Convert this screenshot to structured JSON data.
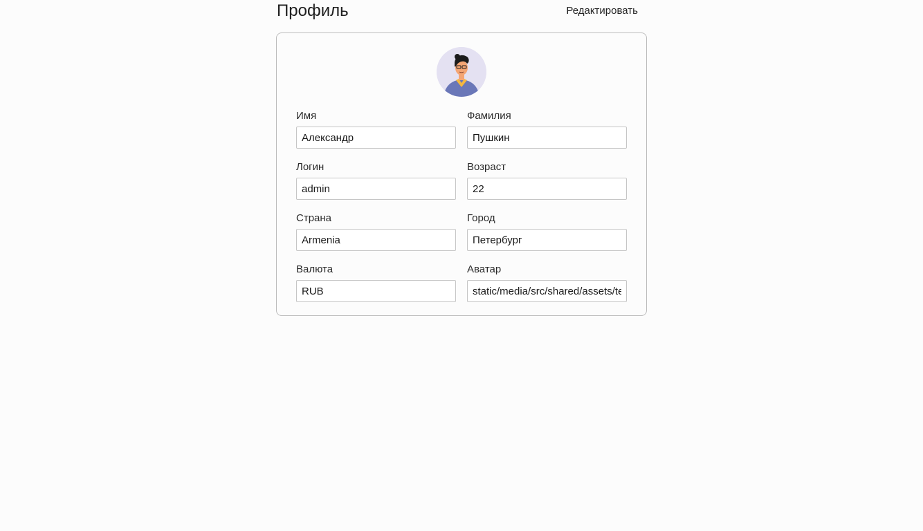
{
  "header": {
    "title": "Профиль",
    "edit_label": "Редактировать"
  },
  "avatar": {
    "icon": "user-avatar-illustration",
    "colors": {
      "background": "#e4e1f2",
      "shirt": "#6a77b8",
      "hair": "#1b1b1b",
      "skin": "#f4a574"
    }
  },
  "form": {
    "first_name": {
      "label": "Имя",
      "value": "Александр"
    },
    "last_name": {
      "label": "Фамилия",
      "value": "Пушкин"
    },
    "login": {
      "label": "Логин",
      "value": "admin"
    },
    "age": {
      "label": "Возраст",
      "value": "22"
    },
    "country": {
      "label": "Страна",
      "value": "Armenia"
    },
    "city": {
      "label": "Город",
      "value": "Петербург"
    },
    "currency": {
      "label": "Валюта",
      "value": "RUB"
    },
    "avatar_url": {
      "label": "Аватар",
      "value": "static/media/src/shared/assets/test/storybook.jpg"
    }
  }
}
